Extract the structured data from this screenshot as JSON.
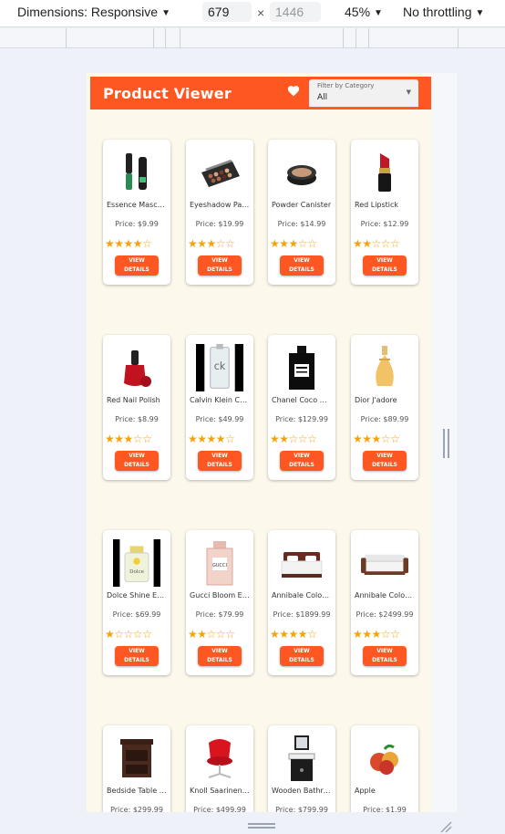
{
  "devtools": {
    "dimensions_label": "Dimensions: Responsive",
    "width_value": "679",
    "times": "×",
    "height_placeholder": "1446",
    "zoom_label": "45%",
    "throttling_label": "No throttling",
    "caret": "▼"
  },
  "app": {
    "title": "Product Viewer",
    "favorites_icon": "heart-icon",
    "filter": {
      "label": "Filter by Category",
      "value": "All",
      "caret": "▼"
    },
    "accent_color": "#ff5722",
    "star_color": "#f2a30f",
    "button_label_line1": "VIEW",
    "button_label_line2": "DETAILS"
  },
  "products": [
    {
      "name": "Essence Mascara Lash Princess",
      "price": "Price: $9.99",
      "rating": 4,
      "icon": "mascara"
    },
    {
      "name": "Eyeshadow Palette with Mirror",
      "price": "Price: $19.99",
      "rating": 3,
      "icon": "eyeshadow"
    },
    {
      "name": "Powder Canister",
      "price": "Price: $14.99",
      "rating": 3,
      "icon": "powder"
    },
    {
      "name": "Red Lipstick",
      "price": "Price: $12.99",
      "rating": 2,
      "icon": "lipstick"
    },
    {
      "name": "Red Nail Polish",
      "price": "Price: $8.99",
      "rating": 3,
      "icon": "nail-polish"
    },
    {
      "name": "Calvin Klein CK One",
      "price": "Price: $49.99",
      "rating": 4,
      "icon": "ck-perfume"
    },
    {
      "name": "Chanel Coco Noir Eau De",
      "price": "Price: $129.99",
      "rating": 2,
      "icon": "chanel-perfume"
    },
    {
      "name": "Dior J'adore",
      "price": "Price: $89.99",
      "rating": 3,
      "icon": "dior-perfume"
    },
    {
      "name": "Dolce Shine Eau de",
      "price": "Price: $69.99",
      "rating": 1,
      "icon": "dolce-perfume"
    },
    {
      "name": "Gucci Bloom Eau de",
      "price": "Price: $79.99",
      "rating": 2,
      "icon": "gucci-perfume"
    },
    {
      "name": "Annibale Colombo Bed",
      "price": "Price: $1899.99",
      "rating": 4,
      "icon": "bed"
    },
    {
      "name": "Annibale Colombo Sofa",
      "price": "Price: $2499.99",
      "rating": 3,
      "icon": "sofa"
    },
    {
      "name": "Bedside Table African Cherry",
      "price": "Price: $299.99",
      "rating": 0,
      "icon": "bedside-table"
    },
    {
      "name": "Knoll Saarinen Executive Conference Chair",
      "price": "Price: $499.99",
      "rating": 0,
      "icon": "chair"
    },
    {
      "name": "Wooden Bathroom Sink With Mirror",
      "price": "Price: $799.99",
      "rating": 0,
      "icon": "sink"
    },
    {
      "name": "Apple",
      "price": "Price: $1.99",
      "rating": 0,
      "icon": "apple"
    }
  ]
}
